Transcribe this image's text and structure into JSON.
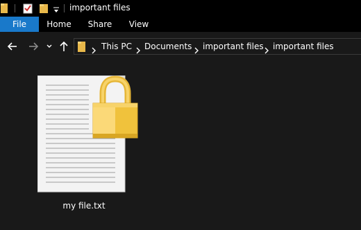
{
  "window": {
    "title": "important files"
  },
  "quick_access": {
    "icons": [
      "folder-icon",
      "properties-icon",
      "new-folder-icon",
      "customize-dropdown-icon"
    ]
  },
  "ribbon": {
    "tabs": [
      {
        "label": "File",
        "active": true
      },
      {
        "label": "Home"
      },
      {
        "label": "Share"
      },
      {
        "label": "View"
      }
    ]
  },
  "navigation": {
    "icons": [
      "back-arrow-icon",
      "forward-arrow-icon",
      "recent-locations-chevron-icon",
      "up-arrow-icon"
    ],
    "breadcrumbs": [
      "This PC",
      "Documents",
      "important files",
      "important files"
    ]
  },
  "content": {
    "items": [
      {
        "name": "my file.txt",
        "icon": "locked-text-file-icon"
      }
    ]
  },
  "colors": {
    "accent": "#1979ca",
    "background": "#191919",
    "titlebar": "#000000",
    "lock_gold": "#f4c842"
  }
}
